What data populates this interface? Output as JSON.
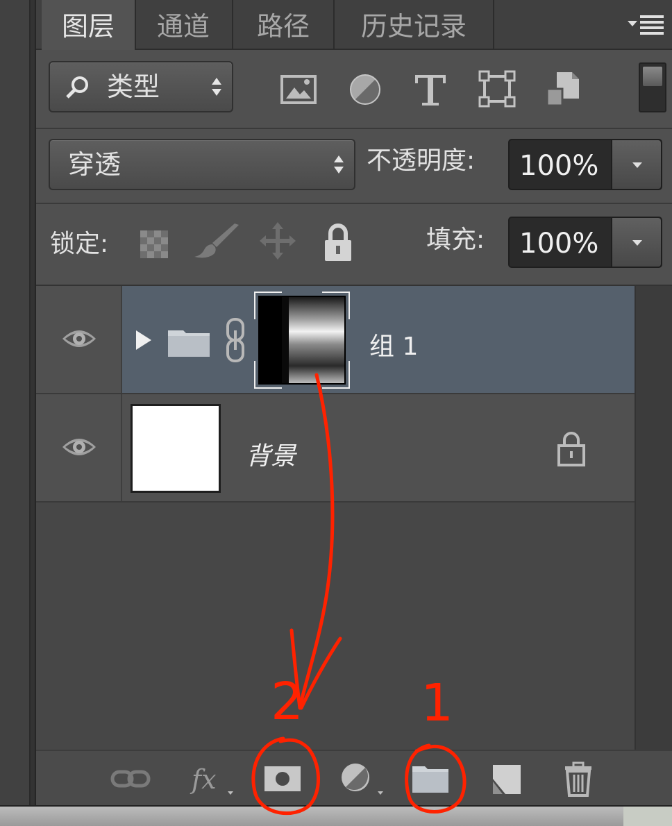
{
  "tabs": [
    "图层",
    "通道",
    "路径",
    "历史记录"
  ],
  "filter": {
    "kind_label": "类型"
  },
  "blend": {
    "mode": "穿透",
    "opacity_label": "不透明度:",
    "opacity_value": "100%"
  },
  "lock": {
    "label": "锁定:",
    "fill_label": "填充:",
    "fill_value": "100%"
  },
  "layers": [
    {
      "name": "组 1",
      "type": "group",
      "selected": true,
      "visible": true
    },
    {
      "name": "背景",
      "type": "background",
      "selected": false,
      "visible": true,
      "locked": true
    }
  ],
  "annotations": {
    "mark_1": "1",
    "mark_2": "2",
    "color": "#ff2200"
  }
}
